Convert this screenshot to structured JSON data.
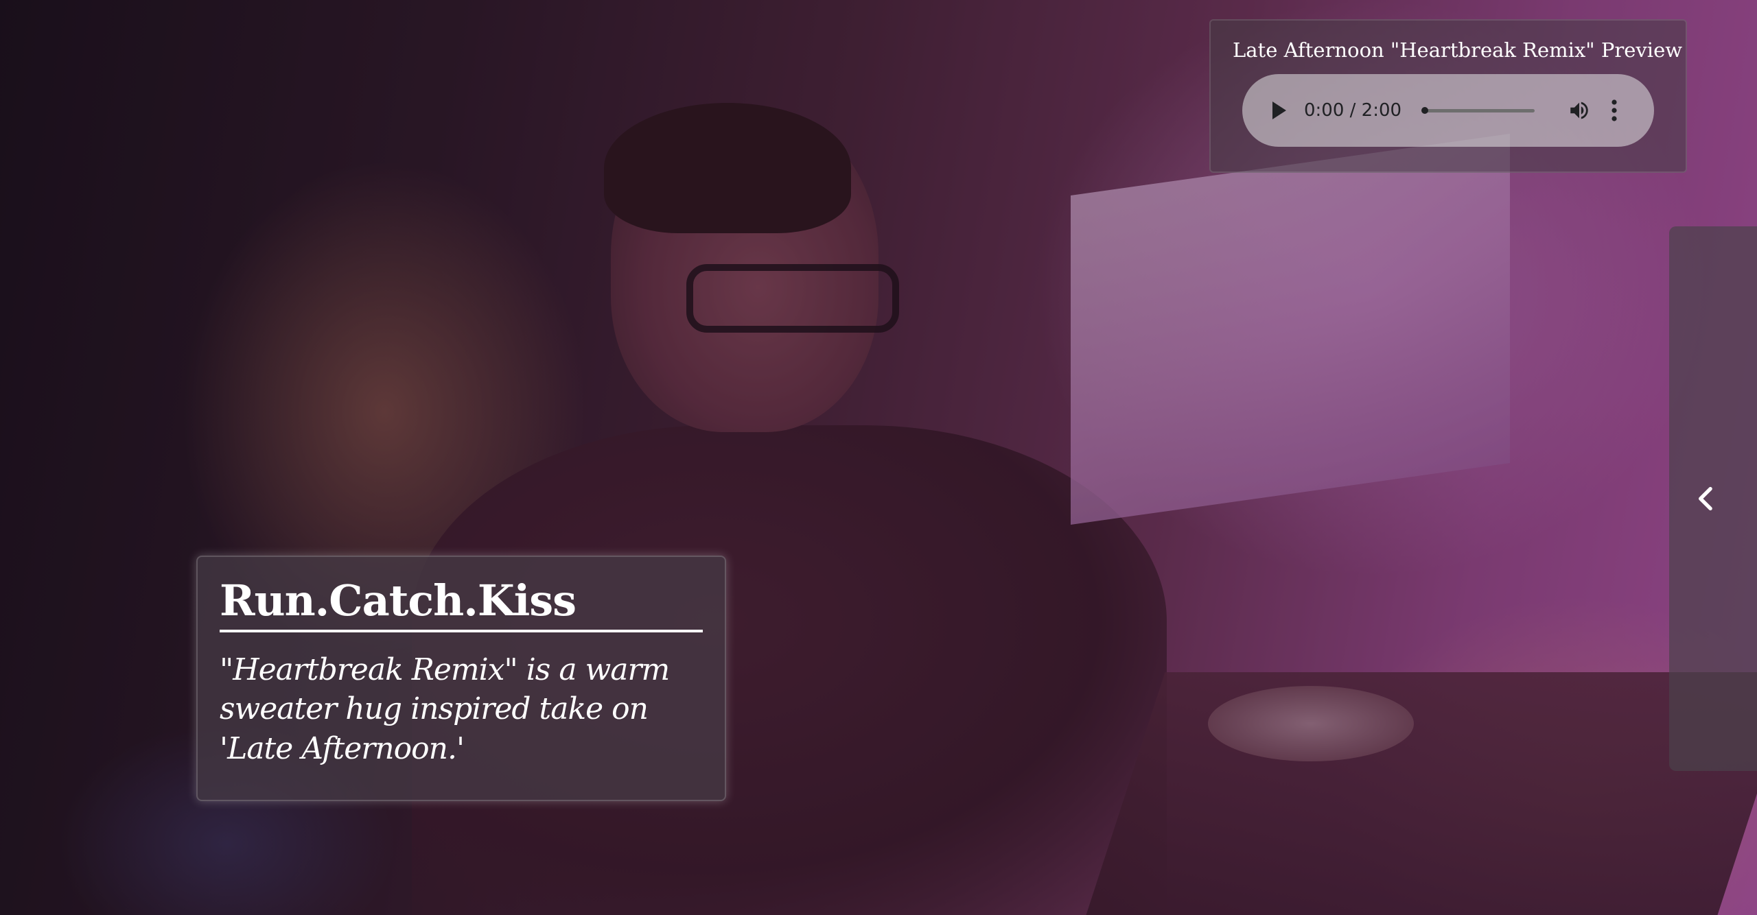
{
  "audio": {
    "title": "Late Afternoon \"Heartbreak Remix\" Preview",
    "current_time": "0:00",
    "duration": "2:00",
    "time_display": "0:00 / 2:00",
    "progress": 0
  },
  "card": {
    "artist": "Run.Catch.Kiss",
    "description": "\"Heartbreak Remix\" is a warm sweater hug inspired take on 'Late Afternoon.'"
  },
  "icons": {
    "play": "play-icon",
    "volume": "volume-icon",
    "menu": "more-vert-icon",
    "drawer": "chevron-left-icon"
  }
}
